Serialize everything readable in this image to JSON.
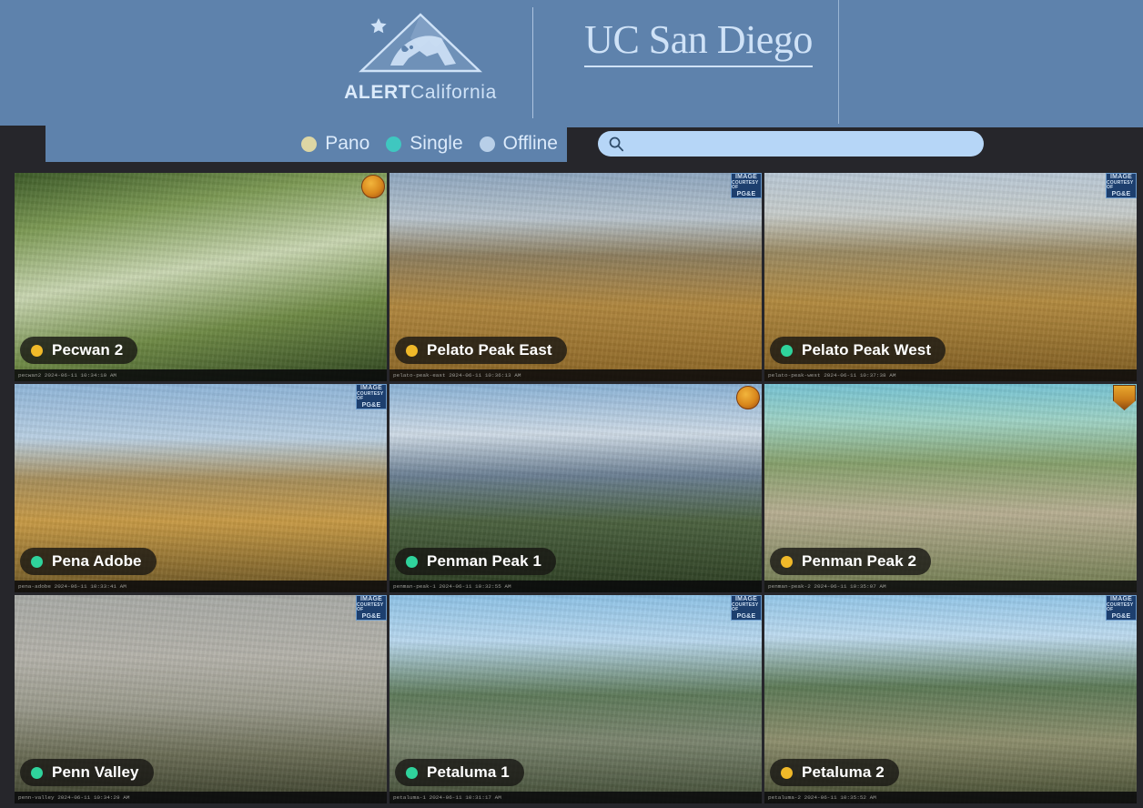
{
  "header": {
    "brand_bold": "ALERT",
    "brand_light": "California",
    "brand_logo_icon": "mountain-bear-star-logo",
    "divider_icon": "vertical-divider",
    "university_line1": "UC",
    "university_line2": "San",
    "university_line3": "Diego",
    "university_full": "UC San Diego"
  },
  "toolbar": {
    "legend": [
      {
        "label": "Pano",
        "color": "#ddd6a4",
        "dot_icon": "pano-status-dot"
      },
      {
        "label": "Single",
        "color": "#3fc7c0",
        "dot_icon": "single-status-dot"
      },
      {
        "label": "Offline",
        "color": "#b8cfe8",
        "dot_icon": "offline-status-dot"
      }
    ],
    "search": {
      "value": "",
      "placeholder": "",
      "icon": "search-icon"
    }
  },
  "grid": {
    "columns": 3,
    "tiles": [
      {
        "name": "Pecwan 2",
        "status": "Pano",
        "dot_color": "#f0b929",
        "badge": "calfire-circle-logo",
        "scene_class": "sc-pecwan",
        "timestamp": "pecwan2 2024-06-11 10:34:10 AM"
      },
      {
        "name": "Pelato Peak East",
        "status": "Pano",
        "dot_color": "#f0b929",
        "badge": "pge-image-logo",
        "scene_class": "sc-pelatoe",
        "timestamp": "pelato-peak-east 2024-06-11 10:36:13 AM"
      },
      {
        "name": "Pelato Peak West",
        "status": "Single",
        "dot_color": "#2fd39c",
        "badge": "pge-image-logo",
        "scene_class": "sc-pelatow",
        "timestamp": "pelato-peak-west 2024-06-11 10:37:38 AM"
      },
      {
        "name": "Pena Adobe",
        "status": "Single",
        "dot_color": "#2fd39c",
        "badge": "pge-image-logo",
        "scene_class": "sc-penaadobe",
        "timestamp": "pena-adobe 2024-06-11 10:33:41 AM"
      },
      {
        "name": "Penman Peak 1",
        "status": "Single",
        "dot_color": "#2fd39c",
        "badge": "calfire-circle-logo",
        "scene_class": "sc-penman1",
        "timestamp": "penman-peak-1 2024-06-11 10:32:55 AM"
      },
      {
        "name": "Penman Peak 2",
        "status": "Pano",
        "dot_color": "#f0b929",
        "badge": "calfire-shield-logo",
        "scene_class": "sc-penman2",
        "timestamp": "penman-peak-2 2024-06-11 10:35:07 AM"
      },
      {
        "name": "Penn Valley",
        "status": "Single",
        "dot_color": "#2fd39c",
        "badge": "pge-image-logo",
        "scene_class": "sc-pennvalley",
        "timestamp": "penn-valley 2024-06-11 10:34:29 AM"
      },
      {
        "name": "Petaluma 1",
        "status": "Single",
        "dot_color": "#2fd39c",
        "badge": "pge-image-logo",
        "scene_class": "sc-petaluma1",
        "timestamp": "petaluma-1 2024-06-11 10:31:17 AM"
      },
      {
        "name": "Petaluma 2",
        "status": "Pano",
        "dot_color": "#f0b929",
        "badge": "pge-image-logo",
        "scene_class": "sc-petaluma2",
        "timestamp": "petaluma-2 2024-06-11 10:35:52 AM"
      }
    ]
  },
  "badge_text": {
    "pge_line1": "IMAGE",
    "pge_line2": "COURTESY OF",
    "pge_line3": "PG&E"
  },
  "colors": {
    "header_blue": "#5e82ac",
    "dark_chrome": "#26262b",
    "search_field": "#b6d6f7",
    "text_light": "#dbeafb"
  }
}
